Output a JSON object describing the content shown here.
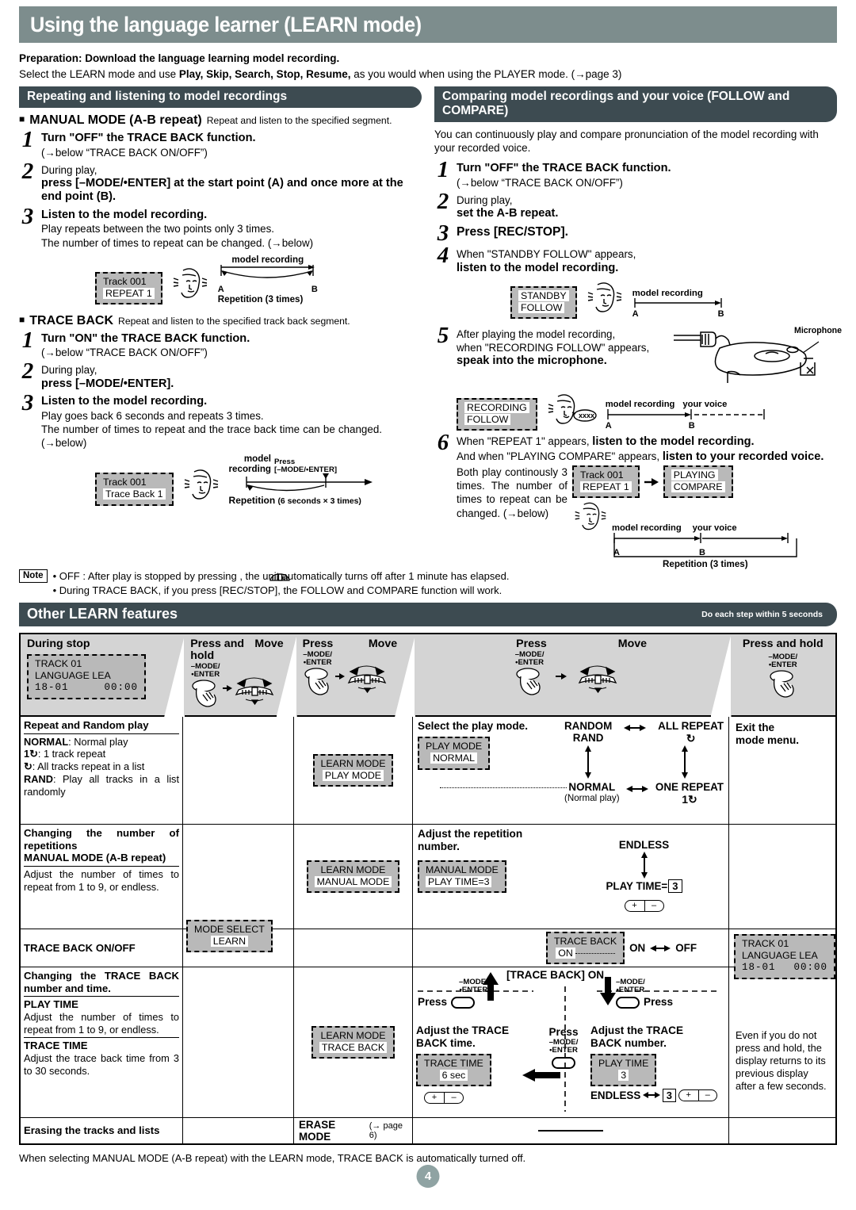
{
  "page": {
    "title": "Using the language learner (LEARN mode)",
    "page_number": "4",
    "footer_note": "When selecting MANUAL MODE (A-B repeat) with the LEARN mode, TRACE BACK is automatically turned off.",
    "header_color": "#7d8d8d",
    "section_header_color": "#3d4b51",
    "lcd_color": "#b9b9b9"
  },
  "preparation": {
    "line1_bold": "Preparation: Download the language learning model recording.",
    "line2_a": "Select the LEARN mode and use ",
    "line2_bold": "Play, Skip, Search, Stop, Resume,",
    "line2_b": " as you would when using the PLAYER mode. (→page 3)"
  },
  "left_section": {
    "header": "Repeating and listening to model recordings",
    "manual": {
      "title": "MANUAL MODE (A-B repeat)",
      "caption": "Repeat and listen to the specified segment.",
      "steps": [
        {
          "num": "1",
          "bold": "Turn \"OFF\" the TRACE BACK function.",
          "plain": "(→below “TRACE BACK ON/OFF”)"
        },
        {
          "num": "2",
          "plain": "During play,",
          "bold": "press [–MODE/•ENTER] at the start point (A) and once more at the end point (B)."
        },
        {
          "num": "3",
          "bold": "Listen to the model recording.",
          "plain": "Play repeats between the two points only 3 times.",
          "plain2": "The number of times to repeat can be changed. (→below)"
        }
      ],
      "lcd_line1": "Track 001",
      "lcd_line2": "REPEAT 1",
      "diagram_top": "model recording",
      "diagram_a": "A",
      "diagram_b": "B",
      "diagram_bottom": "Repetition (3 times)"
    },
    "traceback": {
      "title": "TRACE BACK",
      "caption": "Repeat and listen to the specified track back segment.",
      "steps": [
        {
          "num": "1",
          "bold": "Turn \"ON\" the TRACE BACK function.",
          "plain": "(→below “TRACE BACK ON/OFF”)"
        },
        {
          "num": "2",
          "plain": "During play,",
          "bold": "press [–MODE/•ENTER]."
        },
        {
          "num": "3",
          "bold": "Listen to the model recording.",
          "plain": "Play goes back 6 seconds and repeats 3 times.",
          "plain2": "The number of times to repeat and the trace back time can be changed. (→below)"
        }
      ],
      "lcd_line1": "Track 001",
      "lcd_line2": "Trace Back 1",
      "diagram_press": "Press",
      "diagram_press2": "[–MODE/•ENTER]",
      "diagram_model1": "model",
      "diagram_model2": "recording",
      "diagram_bottom_bold": "Repetition",
      "diagram_bottom_small": "(6 seconds × 3 times)"
    }
  },
  "right_section": {
    "header": "Comparing model recordings and your voice (FOLLOW and COMPARE)",
    "intro": "You can continuously play and compare pronunciation of the model recording with your recorded voice.",
    "steps": [
      {
        "num": "1",
        "bold": "Turn \"OFF\" the TRACE BACK function.",
        "plain": "(→below “TRACE BACK ON/OFF”)"
      },
      {
        "num": "2",
        "plain": "During play,",
        "bold": "set the A-B repeat."
      },
      {
        "num": "3",
        "bold": "Press [REC/STOP]."
      },
      {
        "num": "4",
        "plain": "When \"STANDBY FOLLOW\" appears,",
        "bold": "listen to the model recording."
      },
      {
        "num": "5",
        "plain": "After playing the model recording,",
        "plain2": "when \"RECORDING FOLLOW\" appears,",
        "bold": "speak into the microphone."
      },
      {
        "num": "6",
        "plain": "When \"REPEAT 1\" appears, ",
        "bold": "listen to the model recording.",
        "plain2": "And when \"PLAYING COMPARE\" appears, ",
        "bold2": "listen to your recorded voice.",
        "plain3": "Both play continously 3 times. The number of times to repeat can be changed. (→below)"
      }
    ],
    "lcd_standby_1": "STANDBY",
    "lcd_standby_2": "FOLLOW",
    "lcd_recording_1": "RECORDING",
    "lcd_recording_2": "FOLLOW",
    "lcd_track_1": "Track 001",
    "lcd_track_2": "REPEAT 1",
    "lcd_compare_1": "PLAYING",
    "lcd_compare_2": "COMPARE",
    "microphone_label": "Microphone",
    "bubble_text": "xxxx",
    "diag_model": "model recording",
    "diag_voice": "your voice",
    "diag_a": "A",
    "diag_b": "B",
    "diag_repetition": "Repetition (3 times)"
  },
  "note": {
    "tag": "Note",
    "item1": "• OFF : After play is stopped by pressing      , the unit automatically turns off after 1 minute has elapsed.",
    "item2": "• During TRACE BACK, if you press [REC/STOP], the FOLLOW and COMPARE function will work."
  },
  "other_features": {
    "header": "Other LEARN features",
    "header_right": "Do each step within 5 seconds",
    "columns": [
      {
        "title": "During stop",
        "lcd1": "TRACK 01",
        "lcd2": "LANGUAGE LEA",
        "lcd3a": "18-01",
        "lcd3b": "00:00"
      },
      {
        "title": "Press and hold",
        "title2": "Move",
        "btn1": "–MODE/",
        "btn2": "•ENTER"
      },
      {
        "title": "Press",
        "title2": "Move",
        "btn1": "–MODE/",
        "btn2": "•ENTER"
      },
      {
        "title": "Press",
        "title2": "Move",
        "btn1": "–MODE/",
        "btn2": "•ENTER"
      },
      {
        "title": "Press and hold",
        "btn1": "–MODE/",
        "btn2": "•ENTER"
      }
    ],
    "rows": [
      {
        "label_head": "Repeat and Random play",
        "label_lines": [
          {
            "b": "NORMAL",
            "t": ": Normal play"
          },
          {
            "b": "1↻",
            "t": ": 1 track repeat"
          },
          {
            "b": "↻",
            "t": ":   All tracks repeat in a list"
          },
          {
            "b": "RAND",
            "t": ": Play all tracks in a list randomly"
          }
        ],
        "c3_lcd1": "LEARN MODE",
        "c3_lcd2": "PLAY MODE",
        "c4_title": "Select the play mode.",
        "c4_lcd1": "PLAY  MODE",
        "c4_lcd2": "NORMAL",
        "flow": {
          "tl1": "RANDOM",
          "tl2": "RAND",
          "tr1": "ALL REPEAT",
          "tr2": "↻",
          "bl1": "NORMAL",
          "bl2": "(Normal play)",
          "br1": "ONE REPEAT",
          "br2": "1↻"
        }
      },
      {
        "label_head": "Changing the number of repetitions",
        "label_head2": "MANUAL MODE (A-B repeat)",
        "label_body": "Adjust the number of times to repeat from 1 to 9, or endless.",
        "c3_lcd1": "LEARN MODE",
        "c3_lcd2": "MANUAL MODE",
        "c4_title": "Adjust the repetition number.",
        "c4_lcd1": "MANUAL MODE",
        "c4_lcd2": "PLAY  TIME=3",
        "flow": {
          "top": "ENDLESS",
          "bottom": "PLAY TIME=",
          "boxval": "3",
          "plus": "+",
          "minus": "–"
        }
      },
      {
        "label_head": "TRACE BACK ON/OFF",
        "c4_lcd1": "TRACE BACK",
        "c4_lcd2": "ON",
        "flow_on": "ON",
        "flow_off": "OFF"
      },
      {
        "label_head": "Changing the TRACE BACK number and time.",
        "sub1_head": "PLAY TIME",
        "sub1_body": "Adjust the number of times to repeat from 1 to 9, or endless.",
        "sub2_head": "TRACE TIME",
        "sub2_body": "Adjust the trace back time from 3 to 30 seconds.",
        "c3_lcd1": "LEARN MODE",
        "c3_lcd2": "TRACE BACK",
        "c4_title": "[TRACE BACK] ON",
        "press_left": "Press",
        "press_right": "Press",
        "press_mid": "Press",
        "btn_mode1": "–MODE/",
        "btn_mode2": "•ENTER",
        "left_title1": "Adjust the TRACE",
        "left_title2": "BACK time.",
        "left_lcd1": "TRACE TIME",
        "left_lcd2": "6  sec",
        "right_title1": "Adjust the TRACE",
        "right_title2": "BACK number.",
        "right_lcd1": "PLAY  TIME",
        "right_lcd2": "3",
        "endless": "ENDLESS",
        "endless_box": "3",
        "plus": "+",
        "minus": "–"
      },
      {
        "label_head": "Erasing the tracks and lists",
        "c3_bold": "ERASE MODE",
        "c3_small": "(→ page 6)"
      }
    ],
    "col5_row1": {
      "l1": "Exit the",
      "l2": "mode menu."
    },
    "col5_lcd": {
      "l1": "TRACK 01",
      "l2": "LANGUAGE LEA",
      "l3a": "18-01",
      "l3b": "00:00"
    },
    "col5_text": "Even if you do not press and hold, the display returns to its previous display after a few seconds."
  }
}
